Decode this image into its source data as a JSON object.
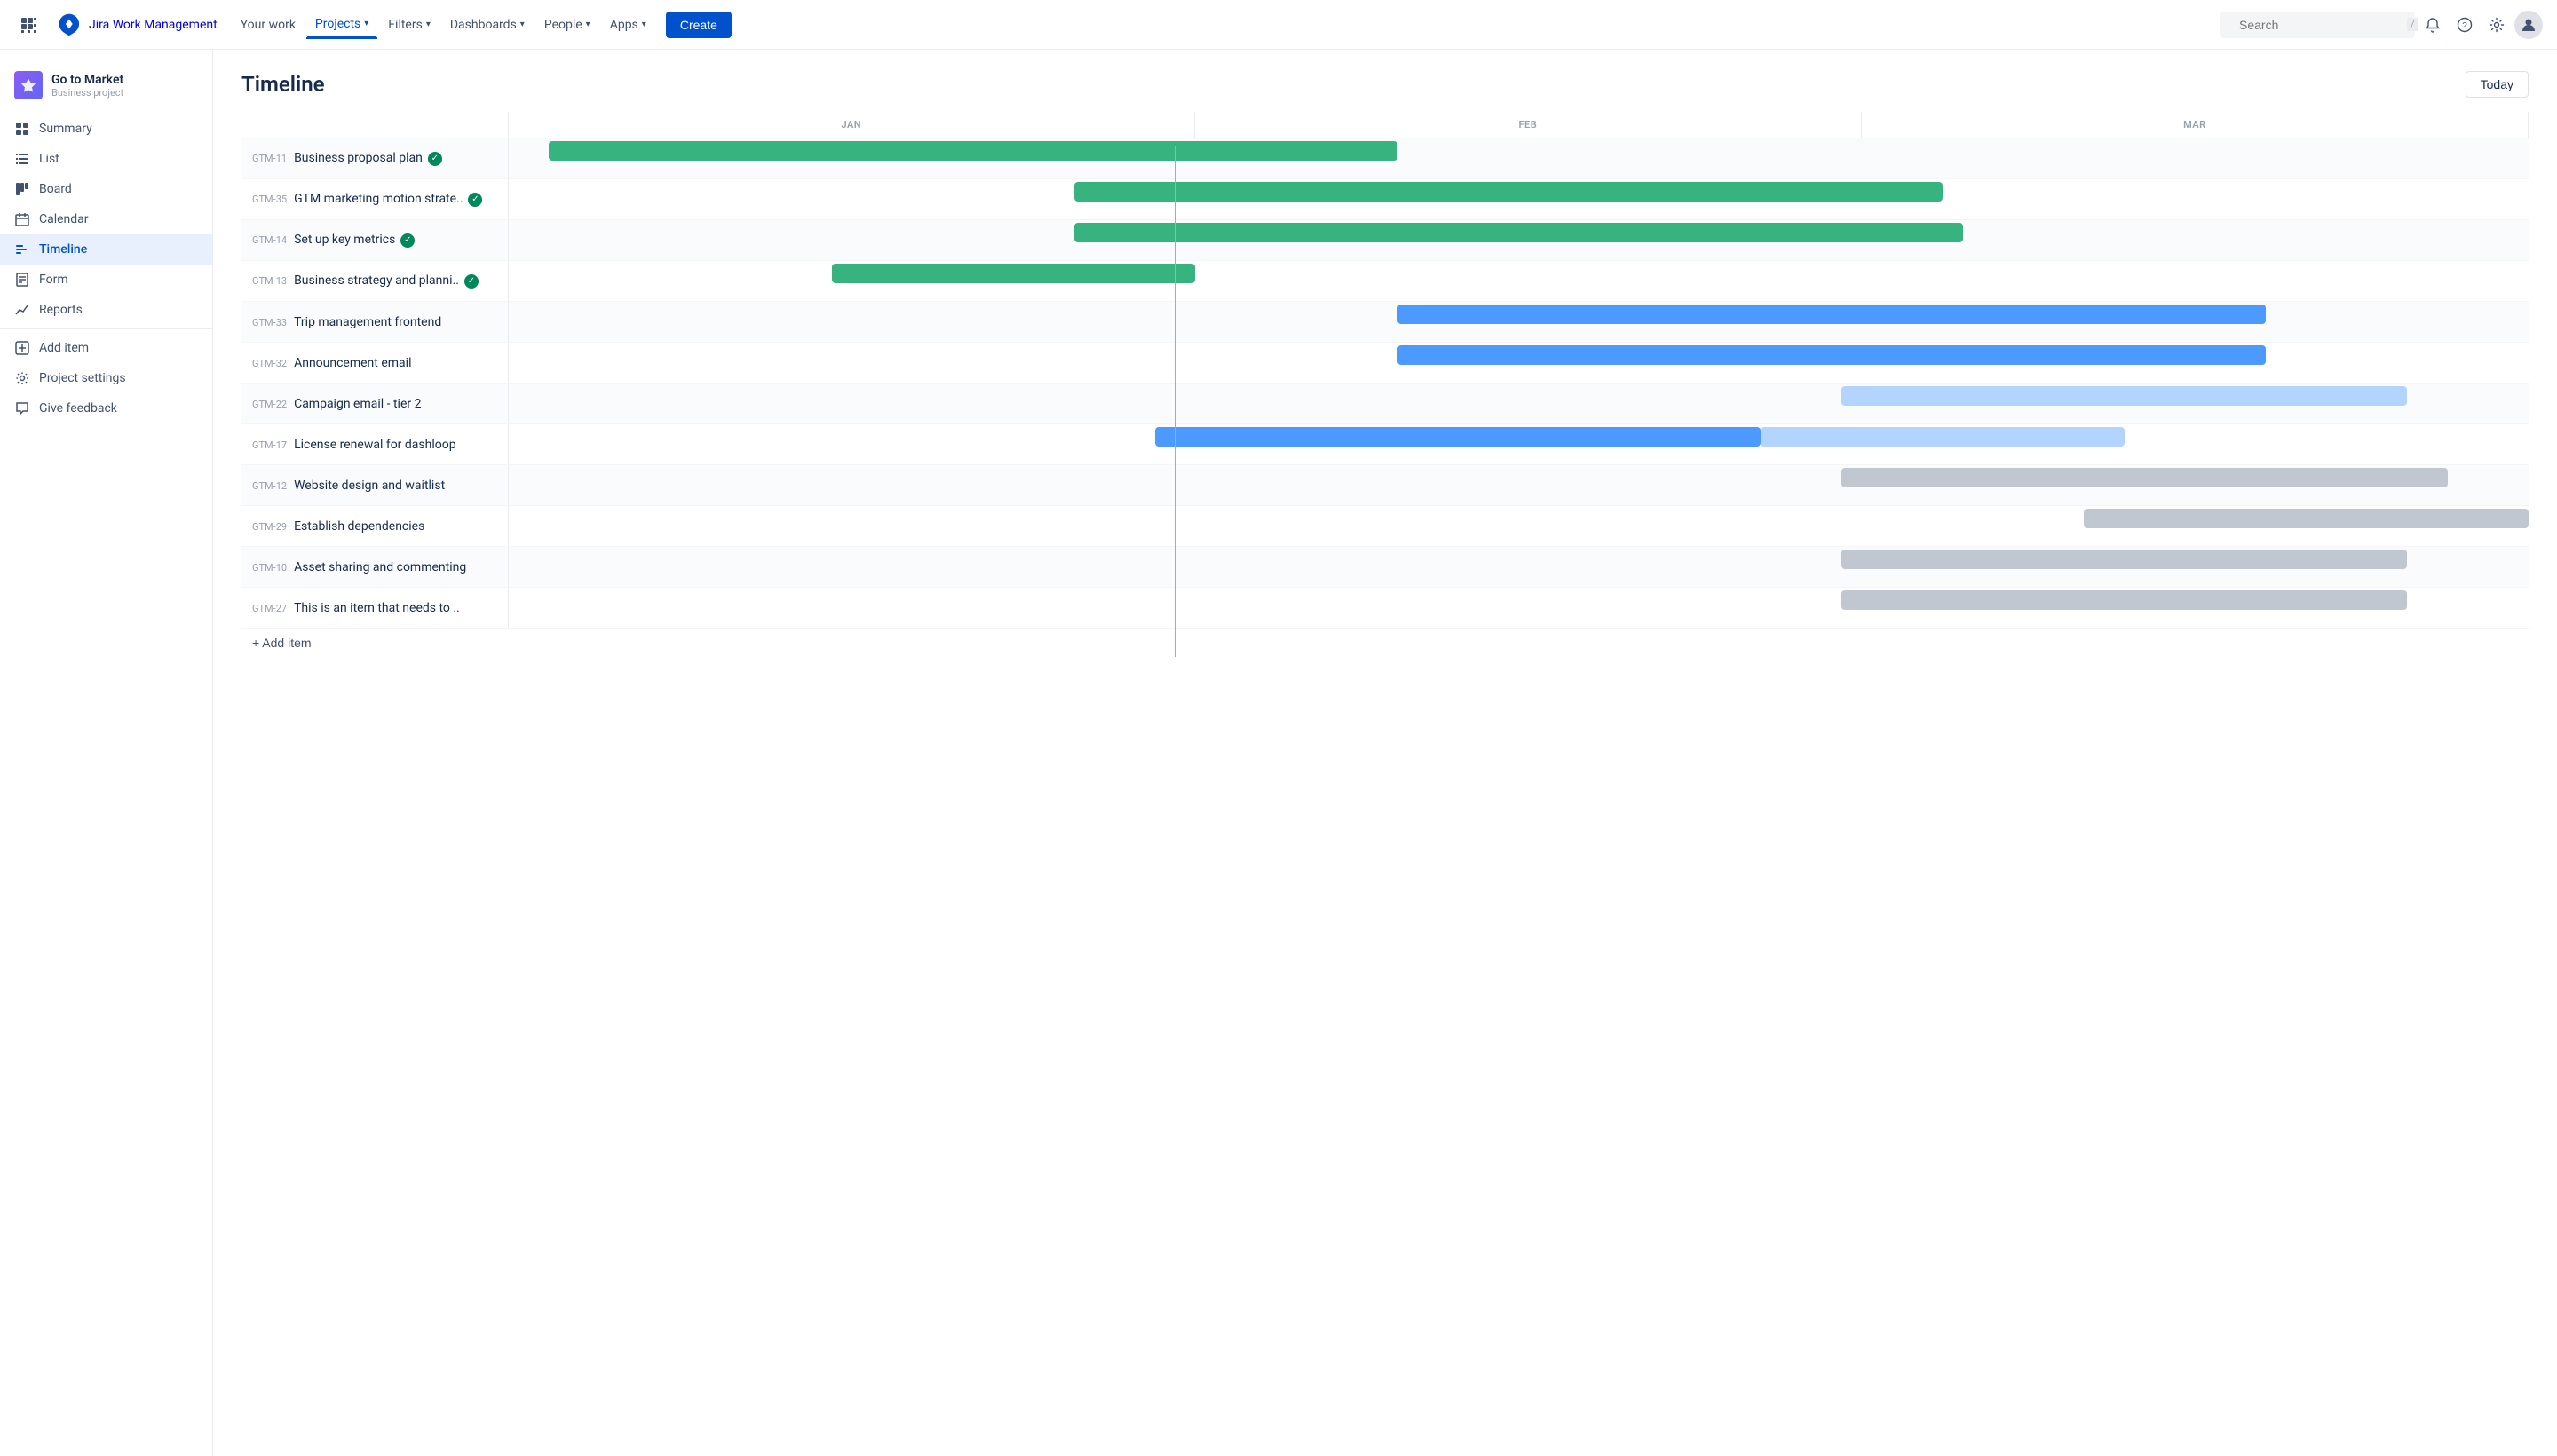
{
  "app": {
    "name": "Jira Work Management"
  },
  "topnav": {
    "logo_text": "Jira Work Management",
    "nav_items": [
      {
        "id": "your-work",
        "label": "Your work"
      },
      {
        "id": "projects",
        "label": "Projects",
        "active": true,
        "has_dropdown": true
      },
      {
        "id": "filters",
        "label": "Filters",
        "has_dropdown": true
      },
      {
        "id": "dashboards",
        "label": "Dashboards",
        "has_dropdown": true
      },
      {
        "id": "people",
        "label": "People",
        "has_dropdown": true
      },
      {
        "id": "apps",
        "label": "Apps",
        "has_dropdown": true
      }
    ],
    "create_label": "Create",
    "search_placeholder": "Search",
    "search_shortcut": "/"
  },
  "sidebar": {
    "project_name": "Go to Market",
    "project_type": "Business project",
    "nav_items": [
      {
        "id": "summary",
        "label": "Summary",
        "icon": "summary"
      },
      {
        "id": "list",
        "label": "List",
        "icon": "list"
      },
      {
        "id": "board",
        "label": "Board",
        "icon": "board"
      },
      {
        "id": "calendar",
        "label": "Calendar",
        "icon": "calendar"
      },
      {
        "id": "timeline",
        "label": "Timeline",
        "icon": "timeline",
        "active": true
      },
      {
        "id": "form",
        "label": "Form",
        "icon": "form"
      },
      {
        "id": "reports",
        "label": "Reports",
        "icon": "reports"
      },
      {
        "id": "add-item",
        "label": "Add item",
        "icon": "add"
      },
      {
        "id": "project-settings",
        "label": "Project settings",
        "icon": "settings"
      },
      {
        "id": "give-feedback",
        "label": "Give feedback",
        "icon": "feedback"
      }
    ]
  },
  "main": {
    "title": "Timeline",
    "today_btn": "Today"
  },
  "timeline": {
    "months": [
      "JAN",
      "FEB",
      "MAR"
    ],
    "today_position_pct": 53,
    "tasks": [
      {
        "id": "GTM-11",
        "name": "Business proposal plan",
        "done": true,
        "bar": {
          "color": "green",
          "start_pct": 2,
          "width_pct": 42
        }
      },
      {
        "id": "GTM-35",
        "name": "GTM marketing motion strate..",
        "done": true,
        "bar": {
          "color": "green",
          "start_pct": 28,
          "width_pct": 43
        }
      },
      {
        "id": "GTM-14",
        "name": "Set up key metrics",
        "done": true,
        "bar": {
          "color": "green",
          "start_pct": 28,
          "width_pct": 44
        }
      },
      {
        "id": "GTM-13",
        "name": "Business strategy and planni..",
        "done": true,
        "bar": {
          "color": "green",
          "start_pct": 16,
          "width_pct": 18
        }
      },
      {
        "id": "GTM-33",
        "name": "Trip management frontend",
        "done": false,
        "bar": {
          "color": "blue",
          "start_pct": 44,
          "width_pct": 43
        }
      },
      {
        "id": "GTM-32",
        "name": "Announcement email",
        "done": false,
        "bar": {
          "color": "blue",
          "start_pct": 44,
          "width_pct": 43
        }
      },
      {
        "id": "GTM-22",
        "name": "Campaign email - tier 2",
        "done": false,
        "bar": {
          "color": "light-blue",
          "start_pct": 66,
          "width_pct": 28
        }
      },
      {
        "id": "GTM-17",
        "name": "License renewal for dashloop",
        "done": false,
        "bar2": {
          "color": "blue",
          "start_pct": 32,
          "width_pct": 30
        },
        "bar3": {
          "color": "light-blue",
          "start_pct": 62,
          "width_pct": 18
        }
      },
      {
        "id": "GTM-12",
        "name": "Website design and waitlist",
        "done": false,
        "bar": {
          "color": "gray",
          "start_pct": 66,
          "width_pct": 30
        }
      },
      {
        "id": "GTM-29",
        "name": "Establish dependencies",
        "done": false,
        "bar": {
          "color": "gray",
          "start_pct": 78,
          "width_pct": 22
        }
      },
      {
        "id": "GTM-10",
        "name": "Asset sharing and commenting",
        "done": false,
        "bar": {
          "color": "gray",
          "start_pct": 66,
          "width_pct": 28
        }
      },
      {
        "id": "GTM-27",
        "name": "This is an item that needs to ..",
        "done": false,
        "bar": {
          "color": "gray",
          "start_pct": 66,
          "width_pct": 28
        }
      }
    ],
    "add_item_label": "+ Add item"
  }
}
